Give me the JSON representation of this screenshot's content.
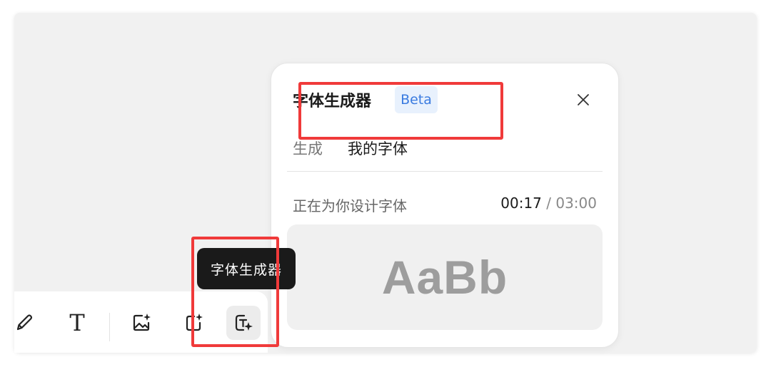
{
  "toolbar": {
    "tools": [
      {
        "name": "pencil-tool",
        "icon": "pencil-icon"
      },
      {
        "name": "text-tool",
        "icon": "text-icon",
        "glyph": "T"
      },
      {
        "name": "image-generate-tool",
        "icon": "image-sparkle-icon"
      },
      {
        "name": "frame-generate-tool",
        "icon": "frame-sparkle-icon"
      },
      {
        "name": "font-generator-tool",
        "icon": "text-sparkle-icon",
        "active": true
      }
    ]
  },
  "tooltip": {
    "label": "字体生成器"
  },
  "panel": {
    "title": "字体生成器",
    "badge": "Beta",
    "close_icon": "close-icon",
    "tabs": [
      {
        "label": "生成",
        "active": false
      },
      {
        "label": "我的字体",
        "active": true
      }
    ],
    "status": "正在为你设计字体",
    "timer": {
      "elapsed": "00:17",
      "separator": "/",
      "total": "03:00"
    },
    "preview_text": "AaBb"
  },
  "colors": {
    "annotation": "#f03a3a",
    "badge_bg": "#e8f1fd",
    "badge_text": "#3a7be0",
    "tooltip_bg": "#1a1a1a"
  }
}
